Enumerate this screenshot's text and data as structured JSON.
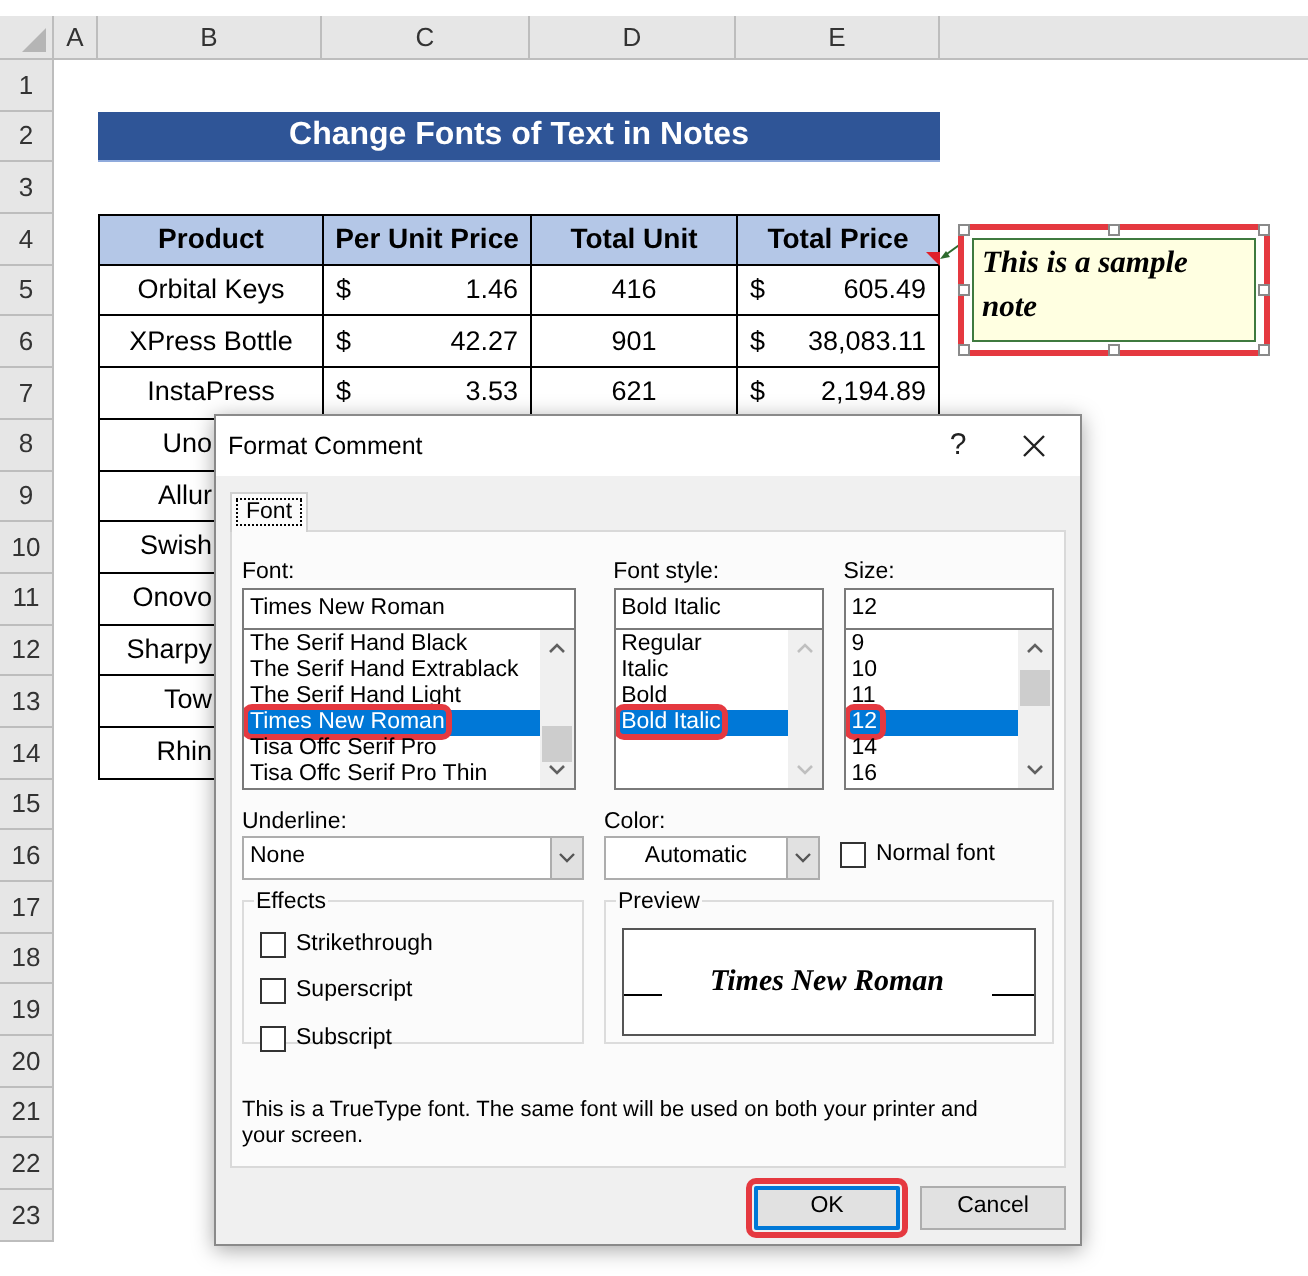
{
  "column_headers": [
    "A",
    "B",
    "C",
    "D",
    "E"
  ],
  "row_headers": [
    "1",
    "2",
    "3",
    "4",
    "5",
    "6",
    "7",
    "8",
    "9",
    "10",
    "11",
    "12",
    "13",
    "14",
    "15",
    "16",
    "17",
    "18",
    "19",
    "20",
    "21",
    "22",
    "23"
  ],
  "title": "Change Fonts of Text in Notes",
  "table": {
    "columns": [
      "Product",
      "Per Unit Price",
      "Total Unit",
      "Total Price"
    ],
    "rows": [
      {
        "product": "Orbital Keys",
        "unit_price": {
          "symbol": "$",
          "amount": "1.46"
        },
        "total_unit": "416",
        "total_price": {
          "symbol": "$",
          "amount": "605.49"
        }
      },
      {
        "product": "XPress Bottle",
        "unit_price": {
          "symbol": "$",
          "amount": "42.27"
        },
        "total_unit": "901",
        "total_price": {
          "symbol": "$",
          "amount": "38,083.11"
        }
      },
      {
        "product": "InstaPress",
        "unit_price": {
          "symbol": "$",
          "amount": "3.53"
        },
        "total_unit": "621",
        "total_price": {
          "symbol": "$",
          "amount": "2,194.89"
        }
      },
      {
        "product": "Uno"
      },
      {
        "product": "Allur"
      },
      {
        "product": "Swish"
      },
      {
        "product": "Onovo"
      },
      {
        "product": "Sharpy"
      },
      {
        "product": "Tow"
      },
      {
        "product": "Rhin"
      }
    ]
  },
  "note": {
    "text": "This is a sample note",
    "selected": true,
    "highlighted": true
  },
  "dialog": {
    "title": "Format Comment",
    "help": "?",
    "tabs": [
      {
        "label": "Font",
        "selected": true
      }
    ],
    "font": {
      "label": "Font:",
      "value": "Times New Roman",
      "items": [
        {
          "label": "The Serif Hand Black",
          "selected": false,
          "highlighted": false
        },
        {
          "label": "The Serif Hand Extrablack",
          "selected": false,
          "highlighted": false
        },
        {
          "label": "The Serif Hand Light",
          "selected": false,
          "highlighted": false
        },
        {
          "label": "Times New Roman",
          "selected": true,
          "highlighted": true
        },
        {
          "label": "Tisa Offc Serif Pro",
          "selected": false,
          "highlighted": false
        },
        {
          "label": "Tisa Offc Serif Pro Thin",
          "selected": false,
          "highlighted": false
        }
      ]
    },
    "style": {
      "label": "Font style:",
      "value": "Bold Italic",
      "items": [
        {
          "label": "Regular",
          "selected": false,
          "highlighted": false
        },
        {
          "label": "Italic",
          "selected": false,
          "highlighted": false
        },
        {
          "label": "Bold",
          "selected": false,
          "highlighted": false
        },
        {
          "label": "Bold Italic",
          "selected": true,
          "highlighted": true
        }
      ]
    },
    "size": {
      "label": "Size:",
      "value": "12",
      "items": [
        {
          "label": "9",
          "selected": false,
          "highlighted": false
        },
        {
          "label": "10",
          "selected": false,
          "highlighted": false
        },
        {
          "label": "11",
          "selected": false,
          "highlighted": false
        },
        {
          "label": "12",
          "selected": true,
          "highlighted": true
        },
        {
          "label": "14",
          "selected": false,
          "highlighted": false
        },
        {
          "label": "16",
          "selected": false,
          "highlighted": false
        }
      ]
    },
    "underline": {
      "label": "Underline:",
      "value": "None"
    },
    "color": {
      "label": "Color:",
      "value": "Automatic"
    },
    "normal_font": {
      "label": "Normal font",
      "checked": false
    },
    "effects": {
      "label": "Effects",
      "items": [
        {
          "label": "Strikethrough",
          "checked": false
        },
        {
          "label": "Superscript",
          "checked": false
        },
        {
          "label": "Subscript",
          "checked": false
        }
      ]
    },
    "preview": {
      "label": "Preview",
      "text": "Times New Roman"
    },
    "info": "This is a TrueType font.  The same font will be used on both your printer and your screen.",
    "buttons": [
      {
        "label": "OK",
        "default": true,
        "highlighted": true
      },
      {
        "label": "Cancel",
        "default": false,
        "highlighted": false
      }
    ]
  }
}
